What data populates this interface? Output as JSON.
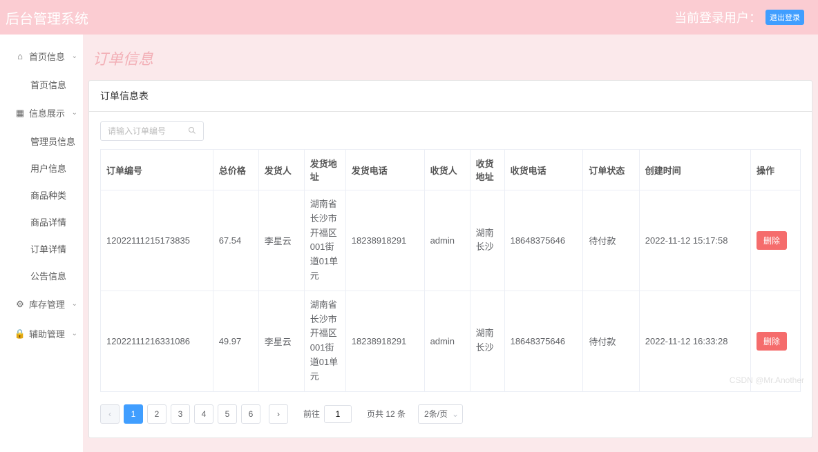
{
  "header": {
    "title": "后台管理系统",
    "current_user_label": "当前登录用户：",
    "logout_label": "退出登录"
  },
  "sidebar": {
    "groups": [
      {
        "label": "首页信息",
        "icon": "home",
        "children": [
          "首页信息"
        ]
      },
      {
        "label": "信息展示",
        "icon": "grid",
        "children": [
          "管理员信息",
          "用户信息",
          "商品种类",
          "商品详情",
          "订单详情",
          "公告信息"
        ]
      },
      {
        "label": "库存管理",
        "icon": "gear",
        "children": []
      },
      {
        "label": "辅助管理",
        "icon": "lock",
        "children": []
      }
    ]
  },
  "page": {
    "title": "订单信息",
    "card_title": "订单信息表",
    "search_placeholder": "请输入订单编号"
  },
  "table": {
    "headers": [
      "订单编号",
      "总价格",
      "发货人",
      "发货地址",
      "发货电话",
      "收货人",
      "收货地址",
      "收货电话",
      "订单状态",
      "创建时间",
      "操作"
    ],
    "rows": [
      {
        "order_no": "12022111215173835",
        "total_price": "67.54",
        "sender": "李星云",
        "sender_addr": "湖南省长沙市开福区001街道01单元",
        "sender_phone": "18238918291",
        "receiver": "admin",
        "receiver_addr": "湖南长沙",
        "receiver_phone": "18648375646",
        "status": "待付款",
        "created_at": "2022-11-12 15:17:58",
        "action": "删除"
      },
      {
        "order_no": "12022111216331086",
        "total_price": "49.97",
        "sender": "李星云",
        "sender_addr": "湖南省长沙市开福区001街道01单元",
        "sender_phone": "18238918291",
        "receiver": "admin",
        "receiver_addr": "湖南长沙",
        "receiver_phone": "18648375646",
        "status": "待付款",
        "created_at": "2022-11-12 16:33:28",
        "action": "删除"
      }
    ]
  },
  "pagination": {
    "pages": [
      "1",
      "2",
      "3",
      "4",
      "5",
      "6"
    ],
    "current": "1",
    "goto_label": "前往",
    "goto_value": "1",
    "total_label": "页共 12 条",
    "size_label": "2条/页"
  },
  "watermark": "CSDN @Mr.Another"
}
